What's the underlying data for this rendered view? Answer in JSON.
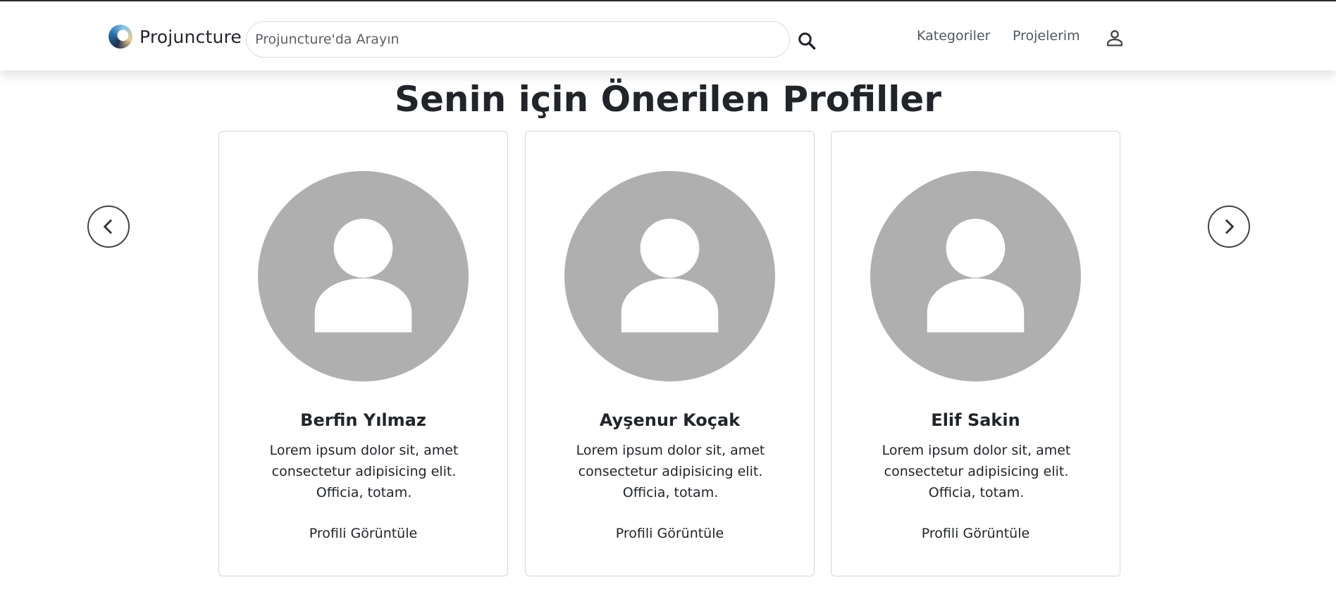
{
  "header": {
    "brand_name": "Projuncture",
    "search_placeholder": "Projuncture'da Arayın",
    "nav": {
      "categories": "Kategoriler",
      "projects": "Projelerim"
    }
  },
  "page": {
    "title": "Senin için Önerilen Profiller"
  },
  "profiles": [
    {
      "name": "Berfin Yılmaz",
      "description": "Lorem ipsum dolor sit, amet consectetur adipisicing elit. Officia, totam.",
      "link_label": "Profili Görüntüle"
    },
    {
      "name": "Ayşenur Koçak",
      "description": "Lorem ipsum dolor sit, amet consectetur adipisicing elit. Officia, totam.",
      "link_label": "Profili Görüntüle"
    },
    {
      "name": "Elif Sakin",
      "description": "Lorem ipsum dolor sit, amet consectetur adipisicing elit. Officia, totam.",
      "link_label": "Profili Görüntüle"
    }
  ],
  "icons": {
    "search": "search-icon",
    "user": "user-icon",
    "prev": "chevron-left-icon",
    "next": "chevron-right-icon"
  },
  "colors": {
    "avatar_bg": "#afafaf",
    "text": "#212529",
    "nav_link": "#50565c"
  }
}
